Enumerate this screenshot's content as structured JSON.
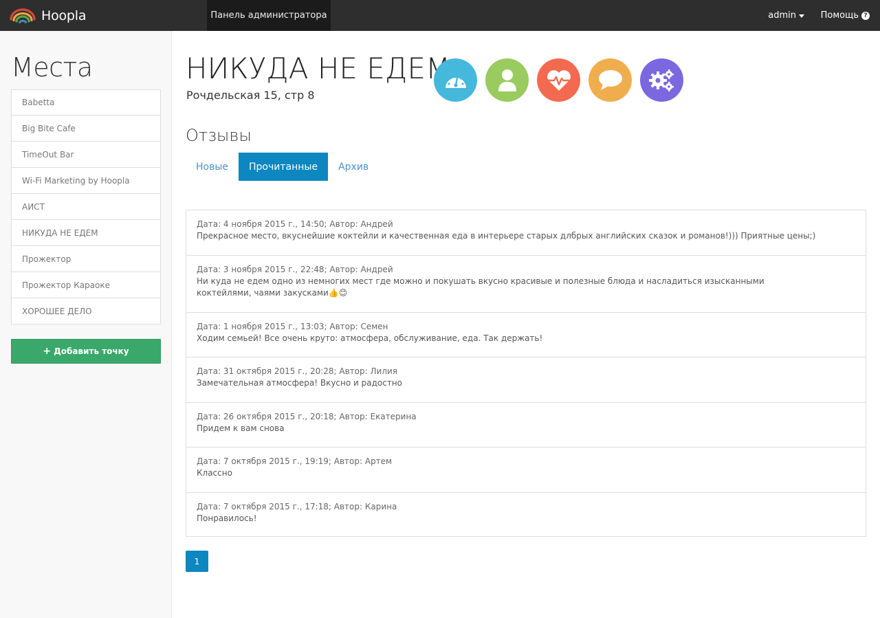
{
  "navbar": {
    "brand": "Hoopla",
    "admin_panel": "Панель администратора",
    "user": "admin",
    "help": "Помощь"
  },
  "sidebar": {
    "title": "Места",
    "places": [
      "Babetta",
      "Big Bite Cafe",
      "TimeOut Bar",
      "Wi-Fi Marketing by Hoopla",
      "АИСТ",
      "НИКУДА НЕ ЕДЕМ",
      "Прожектор",
      "Прожектор Караоке",
      "ХОРОШЕЕ ДЕЛО"
    ],
    "add_button": "Добавить точку"
  },
  "venue": {
    "title": "НИКУДА НЕ ЕДЕМ",
    "address": "Рочдельская 15, стр 8"
  },
  "action_icons": [
    {
      "name": "dashboard-icon",
      "color": "#45b8dc"
    },
    {
      "name": "user-icon",
      "color": "#9acb5f"
    },
    {
      "name": "heartbeat-icon",
      "color": "#f26a50"
    },
    {
      "name": "chat-icon",
      "color": "#f0ad4e"
    },
    {
      "name": "settings-icon",
      "color": "#7b68e0"
    }
  ],
  "reviews_section": {
    "title": "Отзывы",
    "tabs": [
      "Новые",
      "Прочитанные",
      "Архив"
    ],
    "active_tab": "Прочитанные"
  },
  "reviews": [
    {
      "meta": "Дата: 4 ноября 2015 г., 14:50; Автор: Андрей",
      "text": "Прекрасное место, вкуснейшие коктейли и качественная еда в интерьере старых длбрых английских сказок и романов!))) Приятные цены;)",
      "text2": ""
    },
    {
      "meta": "Дата: 3 ноября 2015 г., 22:48; Автор: Андрей",
      "text": "Ни куда не едем одно из немногих мест где можно и покушать вкусно красивые и полезные блюда и насладиться изысканными",
      "text2": "коктейлями, чаями закусками👍😊"
    },
    {
      "meta": "Дата: 1 ноября 2015 г., 13:03; Автор: Семен",
      "text": "Ходим семьей! Все очень круто: атмосфера, обслуживание, еда. Так держать!",
      "text2": ""
    },
    {
      "meta": "Дата: 31 октября 2015 г., 20:28; Автор: Лилия",
      "text": "Замечательная атмосфера! Вкусно и радостно",
      "text2": ""
    },
    {
      "meta": "Дата: 26 октября 2015 г., 20:18; Автор: Екатерина",
      "text": "Придем к вам снова",
      "text2": ""
    },
    {
      "meta": "Дата: 7 октября 2015 г., 19:19; Автор: Артем",
      "text": "Классно",
      "text2": ""
    },
    {
      "meta": "Дата: 7 октября 2015 г., 17:18; Автор: Карина",
      "text": "Понравилось!",
      "text2": ""
    }
  ],
  "pagination": {
    "current_page": "1"
  }
}
